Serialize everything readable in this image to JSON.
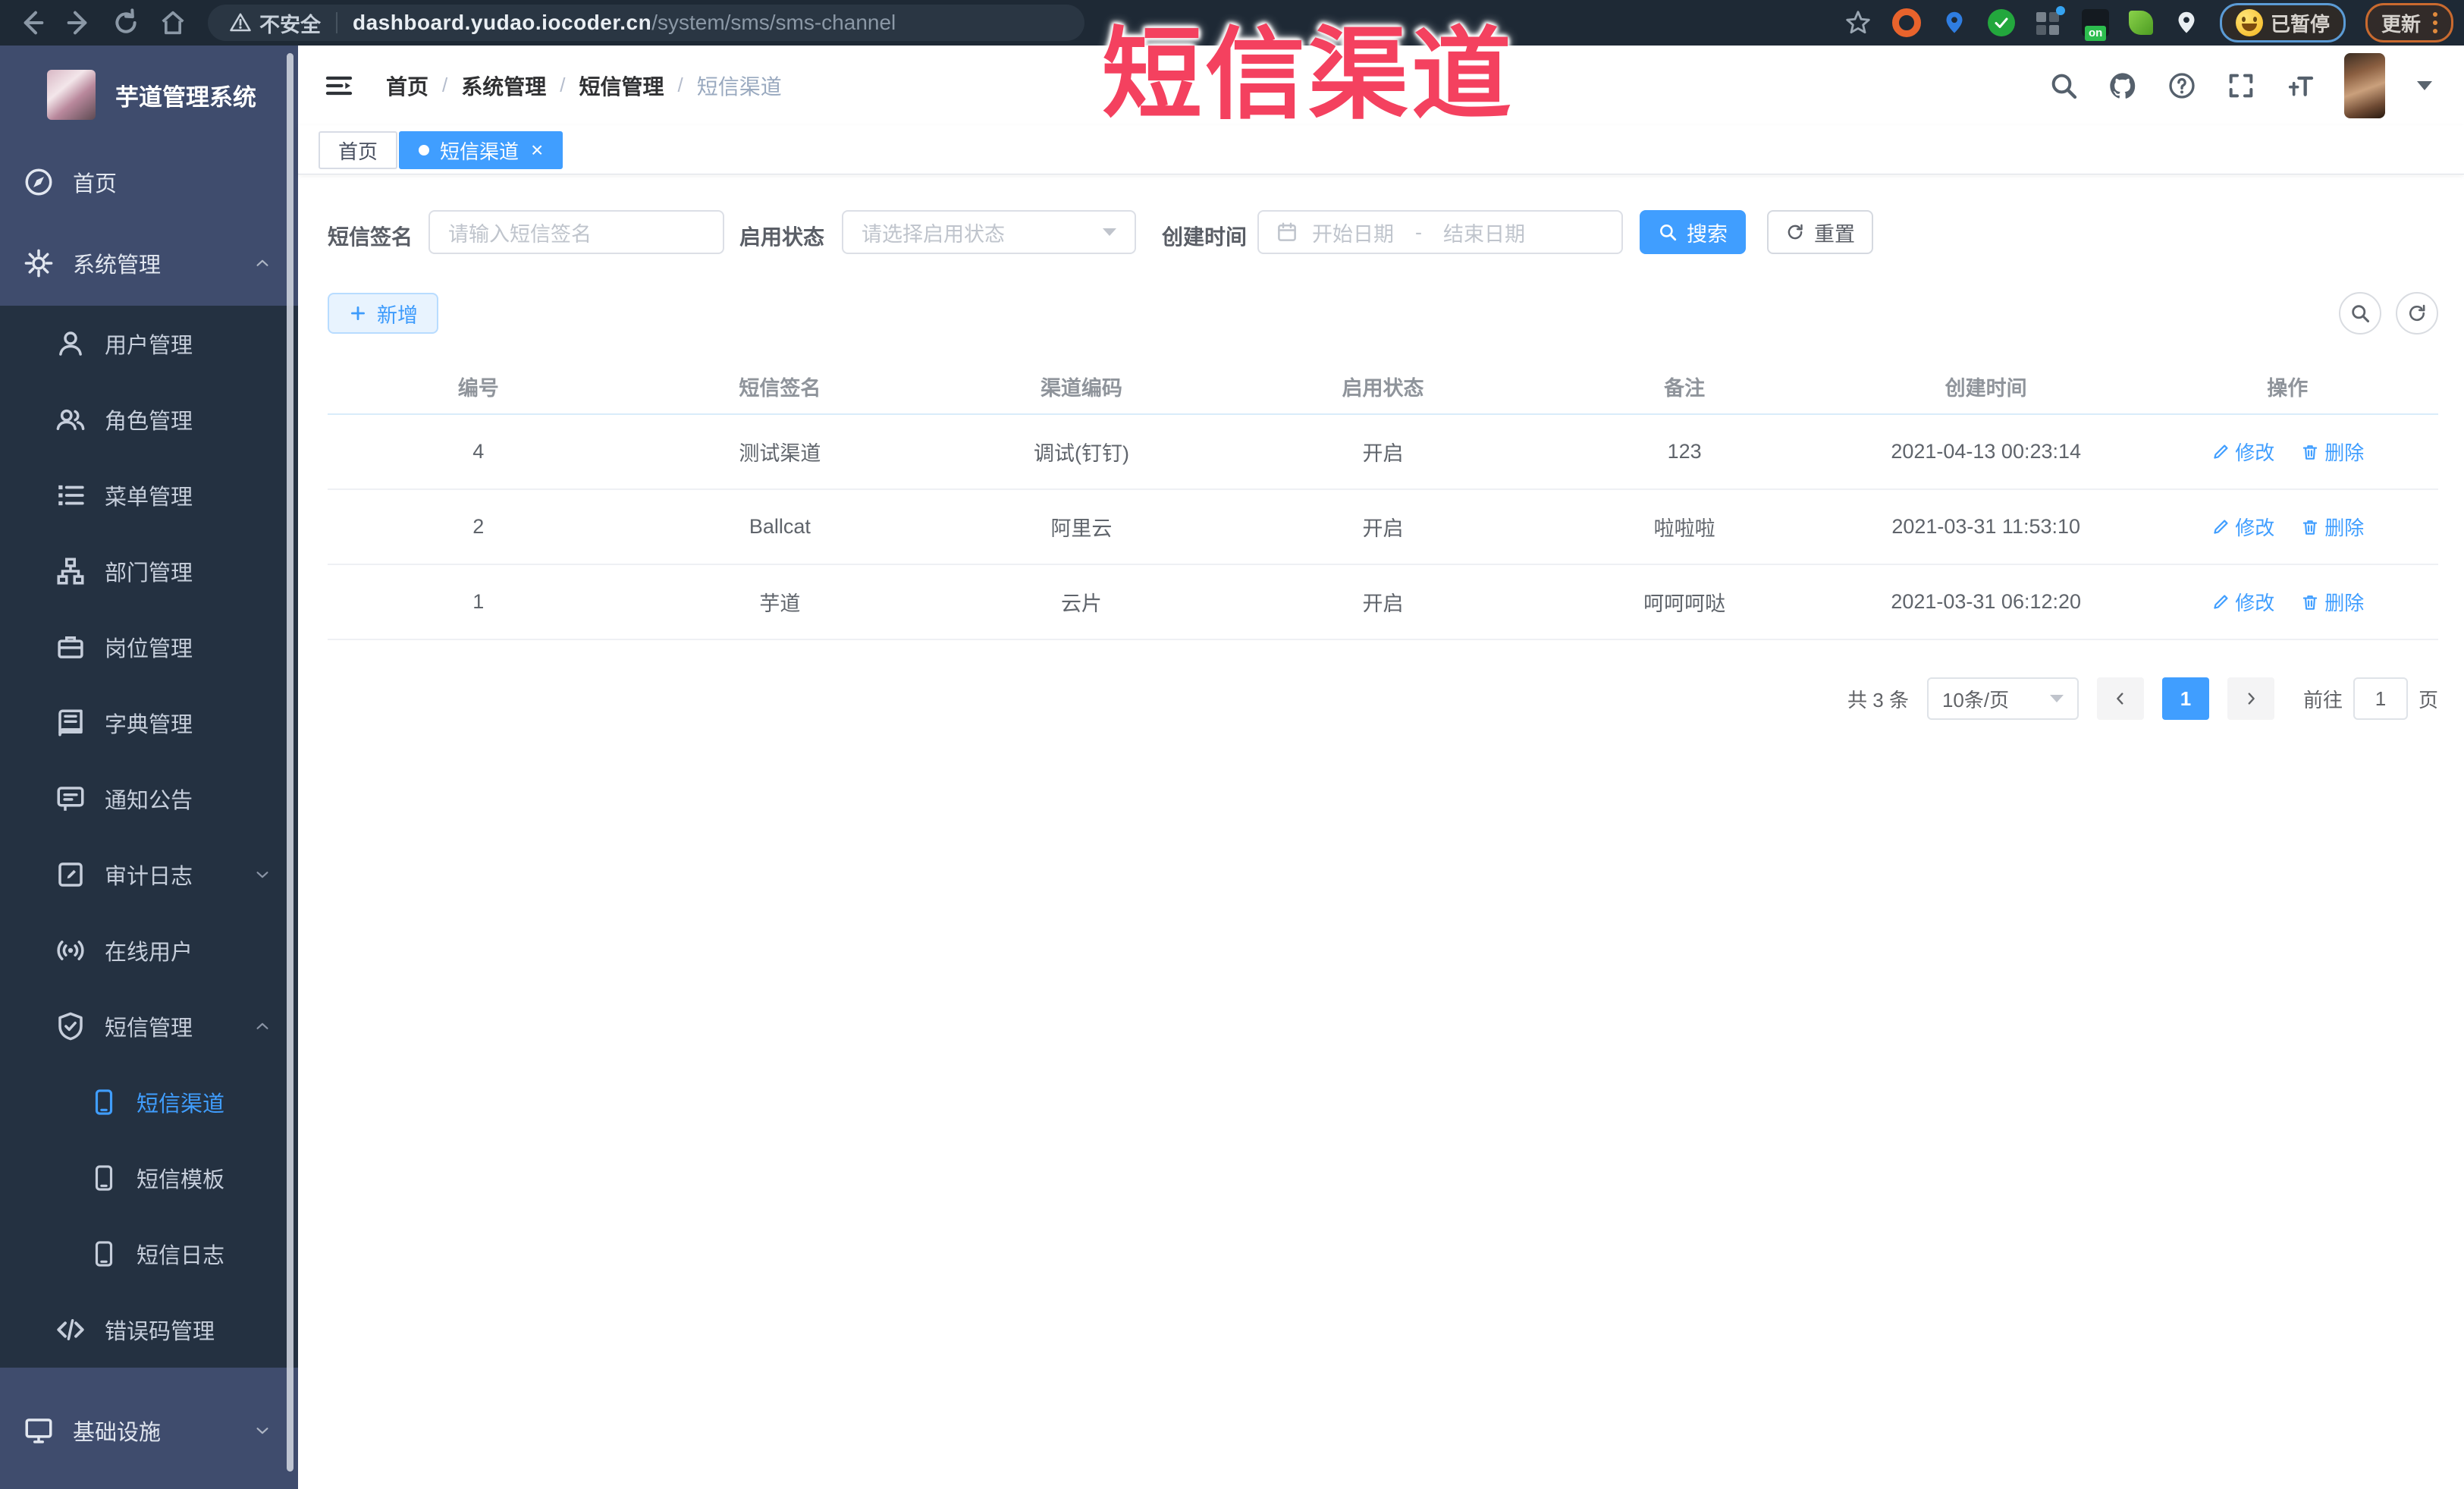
{
  "browser": {
    "security_label": "不安全",
    "url_host": "dashboard.yudao.iocoder.cn",
    "url_path": "/system/sms/sms-channel",
    "extension_on_label": "on",
    "paused_label": "已暂停",
    "update_label": "更新"
  },
  "annotation": {
    "title": "短信渠道",
    "color": "#f4415f"
  },
  "sidebar": {
    "app_title": "芋道管理系统",
    "colors": {
      "menu_bg": "#3f4c6d",
      "submenu_bg": "#243141",
      "active_text": "#409eff"
    },
    "items": [
      {
        "label": "首页"
      },
      {
        "label": "系统管理"
      },
      {
        "label": "用户管理"
      },
      {
        "label": "角色管理"
      },
      {
        "label": "菜单管理"
      },
      {
        "label": "部门管理"
      },
      {
        "label": "岗位管理"
      },
      {
        "label": "字典管理"
      },
      {
        "label": "通知公告"
      },
      {
        "label": "审计日志"
      },
      {
        "label": "在线用户"
      },
      {
        "label": "短信管理"
      },
      {
        "label": "短信渠道"
      },
      {
        "label": "短信模板"
      },
      {
        "label": "短信日志"
      },
      {
        "label": "错误码管理"
      },
      {
        "label": "基础设施"
      }
    ]
  },
  "header": {
    "breadcrumb": [
      "首页",
      "系统管理",
      "短信管理",
      "短信渠道"
    ],
    "separator": "/"
  },
  "tabs": [
    {
      "label": "首页"
    },
    {
      "label": "短信渠道",
      "close_glyph": "×"
    }
  ],
  "filters": {
    "sign_label": "短信签名",
    "sign_placeholder": "请输入短信签名",
    "status_label": "启用状态",
    "status_placeholder": "请选择启用状态",
    "time_label": "创建时间",
    "date_start_placeholder": "开始日期",
    "date_separator": "-",
    "date_end_placeholder": "结束日期",
    "search_label": "搜索",
    "reset_label": "重置"
  },
  "toolbar": {
    "add_label": "新增"
  },
  "table": {
    "columns": [
      "编号",
      "短信签名",
      "渠道编码",
      "启用状态",
      "备注",
      "创建时间",
      "操作"
    ],
    "rows": [
      {
        "id": "4",
        "sign": "测试渠道",
        "code": "调试(钉钉)",
        "status": "开启",
        "remark": "123",
        "created": "2021-04-13 00:23:14"
      },
      {
        "id": "2",
        "sign": "Ballcat",
        "code": "阿里云",
        "status": "开启",
        "remark": "啦啦啦",
        "created": "2021-03-31 11:53:10"
      },
      {
        "id": "1",
        "sign": "芋道",
        "code": "云片",
        "status": "开启",
        "remark": "呵呵呵哒",
        "created": "2021-03-31 06:12:20"
      }
    ],
    "edit_label": "修改",
    "delete_label": "删除"
  },
  "pagination": {
    "total_label": "共 3 条",
    "page_size_label": "10条/页",
    "current_page": "1",
    "goto_label": "前往",
    "goto_value": "1",
    "page_unit_label": "页"
  },
  "theme": {
    "accent": "#409eff"
  }
}
